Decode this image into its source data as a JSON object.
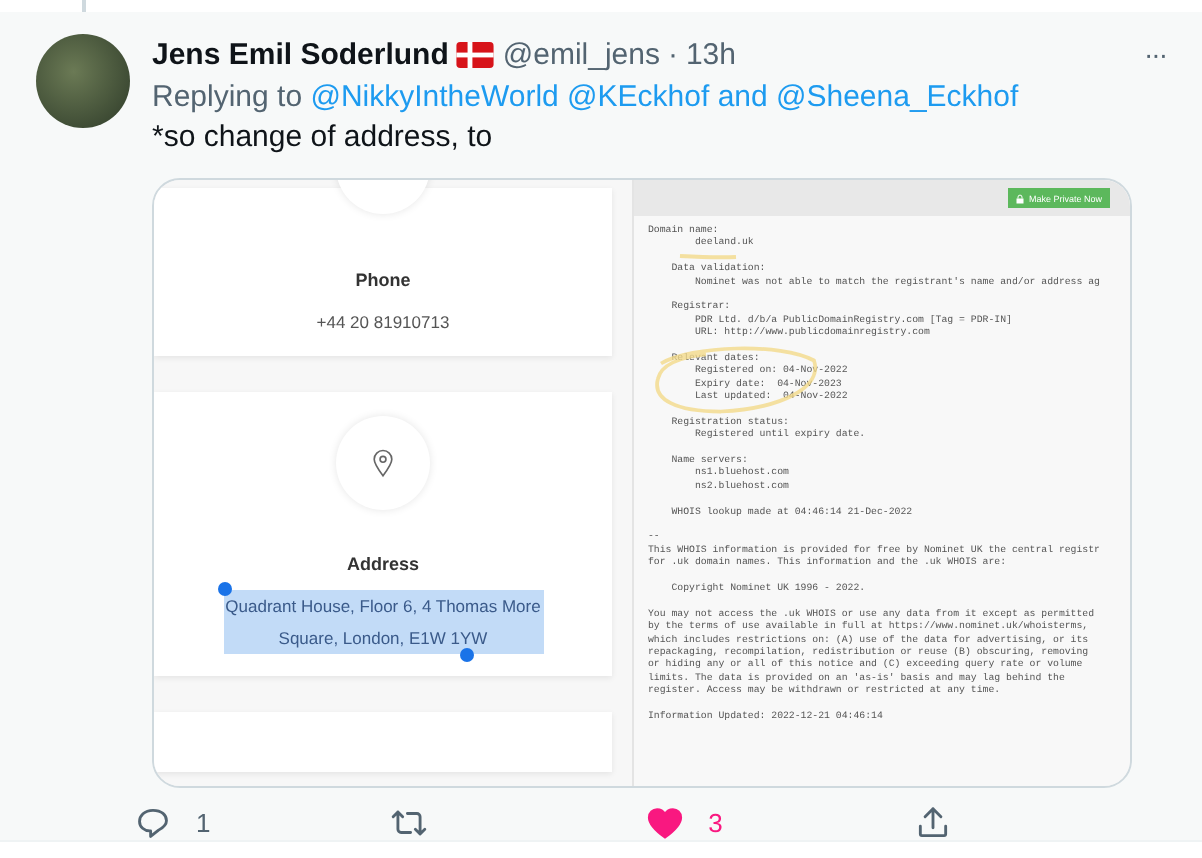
{
  "tweet": {
    "author": "Jens Emil Soderlund",
    "handle": "@emil_jens",
    "separator": "·",
    "time": "13h",
    "more": "···",
    "reply_parts": [
      {
        "kind": "label",
        "text": "Replying to"
      },
      {
        "kind": "mention",
        "text": "@NikkyIntheWorld"
      },
      {
        "kind": "mention",
        "text": "@KEckhof"
      },
      {
        "kind": "joiner",
        "text": "and"
      },
      {
        "kind": "mention",
        "text": "@Sheena_Eckhof"
      }
    ],
    "text": "*so change of address, to"
  },
  "image": {
    "contact_cards": [
      {
        "kind": "phone",
        "title": "Phone",
        "value": "+44 20 81910713",
        "selected": false
      },
      {
        "kind": "address",
        "title": "Address",
        "value": "Quadrant House, Floor 6, 4 Thomas More Square, London, E1W 1YW",
        "selected": true
      }
    ],
    "whois_button": "Make Private Now",
    "whois_blocks": [
      [
        "Domain name:",
        "        deeland.uk"
      ],
      [
        "    Data validation:",
        "        Nominet was not able to match the registrant's name and/or address ag"
      ],
      [
        "    Registrar:",
        "        PDR Ltd. d/b/a PublicDomainRegistry.com [Tag = PDR-IN]",
        "        URL: http://www.publicdomainregistry.com"
      ],
      [
        "    Relevant dates:",
        "        Registered on: 04-Nov-2022",
        "        Expiry date:  04-Nov-2023",
        "        Last updated:  04-Nov-2022"
      ],
      [
        "    Registration status:",
        "        Registered until expiry date."
      ],
      [
        "    Name servers:",
        "        ns1.bluehost.com",
        "        ns2.bluehost.com"
      ],
      [
        "    WHOIS lookup made at 04:46:14 21-Dec-2022"
      ],
      [
        "--",
        "This WHOIS information is provided for free by Nominet UK the central registr",
        "for .uk domain names. This information and the .uk WHOIS are:"
      ],
      [
        "    Copyright Nominet UK 1996 - 2022."
      ],
      [
        "You may not access the .uk WHOIS or use any data from it except as permitted",
        "by the terms of use available in full at https://www.nominet.uk/whoisterms,",
        "which includes restrictions on: (A) use of the data for advertising, or its",
        "repackaging, recompilation, redistribution or reuse (B) obscuring, removing",
        "or hiding any or all of this notice and (C) exceeding query rate or volume",
        "limits. The data is provided on an 'as-is' basis and may lag behind the",
        "register. Access may be withdrawn or restricted at any time."
      ],
      [
        "Information Updated: 2022-12-21 04:46:14"
      ]
    ]
  },
  "actions": [
    {
      "kind": "reply",
      "count": "1",
      "selected": false
    },
    {
      "kind": "retweet",
      "selected": false
    },
    {
      "kind": "like",
      "count": "3",
      "selected": true
    },
    {
      "kind": "share",
      "selected": false
    }
  ]
}
